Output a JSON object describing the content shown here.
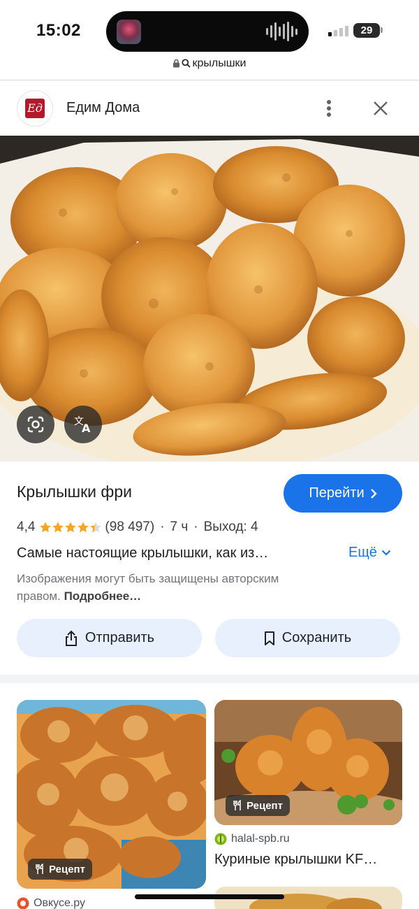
{
  "status_bar": {
    "time": "15:02",
    "battery": "29"
  },
  "browser": {
    "url_text": "крылышки"
  },
  "source": {
    "name": "Едим Дома",
    "logo_text": "Ед",
    "brand_color": "#b3182b"
  },
  "result": {
    "title": "Крылышки фри",
    "visit_label": "Перейти",
    "rating": "4,4",
    "rating_value": 4.4,
    "rating_max": 5,
    "reviews": "(98 497)",
    "duration": "7 ч",
    "yield": "Выход: 4",
    "description": "Самые настоящие крылышки, как из…",
    "more_label": "Ещё",
    "copyright_text": "Изображения могут быть защищены авторским правом.",
    "copyright_link": "Подробнее…",
    "share_label": "Отправить",
    "save_label": "Сохранить"
  },
  "related": [
    {
      "badge": "Рецепт",
      "source": "Овкусе.ру",
      "title": ""
    },
    {
      "badge": "Рецепт",
      "source": "halal-spb.ru",
      "title": "Куриные крылышки KF…"
    }
  ],
  "colors": {
    "accent": "#1a73e8",
    "button_bg": "#e8f0fe",
    "star": "#f5a623"
  },
  "icons": {
    "lens": "google-lens-icon",
    "translate": "translate-icon",
    "share": "share-icon",
    "save": "bookmark-icon",
    "recipe": "fork-knife-icon",
    "more": "more-vert-icon",
    "close": "close-icon"
  }
}
